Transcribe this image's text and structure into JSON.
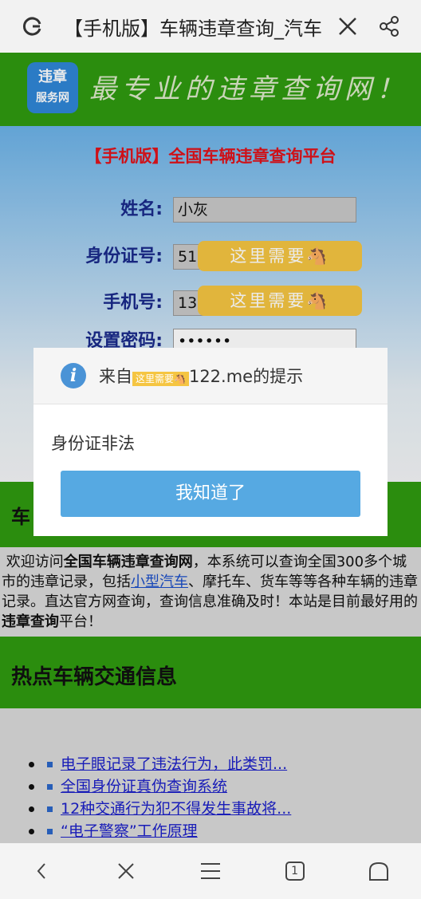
{
  "browser": {
    "tab_title": "【手机版】车辆违章查询_汽车",
    "close_label": "×",
    "nav": {
      "back": "back",
      "close": "close",
      "menu": "menu",
      "tabs_count": "1",
      "home": "home"
    }
  },
  "banner": {
    "logo_line1": "违章",
    "logo_line2": "服务网",
    "slogan": "最专业的违章查询网！"
  },
  "form": {
    "title": "【手机版】全国车辆违章查询平台",
    "name_label": "姓名:",
    "name_value": "小灰",
    "id_label": "身份证号:",
    "id_value": "513",
    "phone_label": "手机号:",
    "phone_value": "13",
    "password_label": "设置密码:",
    "password_value": "••••••",
    "sticker_text": "这里需要🐴"
  },
  "section1": {
    "title_start": "车"
  },
  "intro": {
    "p1": "欢迎访问",
    "b1": "全国车辆违章查询网",
    "p2": "，本系统可以查询全国300多个城市的违章记录，包括",
    "link": "小型汽车",
    "p3": "、摩托车、货车等等各种车辆的违章记录。直达官方网查询，查询信息准确及时！本站是目前最好用的",
    "b2": "违章查询",
    "p4": "平台！"
  },
  "hot": {
    "title": "热点车辆交通信息",
    "items": [
      "电子眼记录了违法行为，此类罚...",
      "全国身份证真伪查询系统",
      "12种交通行为犯不得发生事故将...",
      "“电子警察”工作原理"
    ]
  },
  "dialog": {
    "title_prefix": "来自",
    "title_suffix": "122.me的提示",
    "sticker": "这里需要🐴",
    "message": "身份证非法",
    "button": "我知道了"
  },
  "colors": {
    "green": "#2f9a10",
    "button_blue": "#56a9e2",
    "form_title_red": "#e0131b",
    "label_blue": "#1a2a8a"
  }
}
